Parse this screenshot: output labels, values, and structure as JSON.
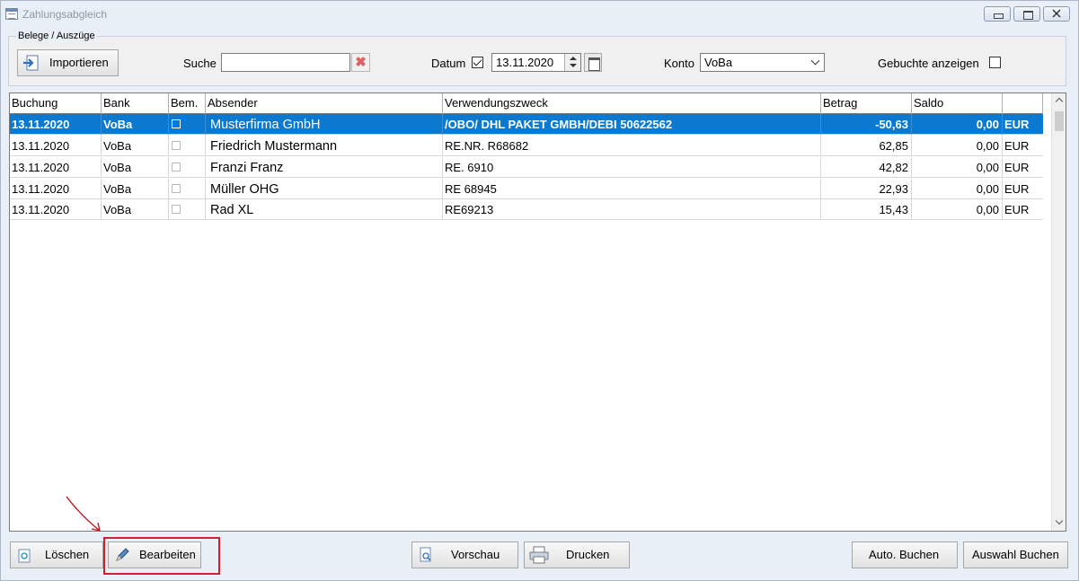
{
  "window": {
    "title": "Zahlungsabgleich"
  },
  "toolbar": {
    "group_label": "Belege / Auszüge",
    "import_label": "Importieren",
    "search_label": "Suche",
    "search_value": "",
    "date_label": "Datum",
    "date_enabled": true,
    "date_value": "13.11.2020",
    "account_label": "Konto",
    "account_value": "VoBa",
    "booked_label": "Gebuchte anzeigen",
    "booked_checked": false
  },
  "grid": {
    "columns": [
      "Buchung",
      "Bank",
      "Bem.",
      "Absender",
      "Verwendungszweck",
      "Betrag",
      "Saldo",
      ""
    ],
    "rows": [
      {
        "date": "13.11.2020",
        "bank": "VoBa",
        "note": false,
        "sender": "Musterfirma GmbH",
        "purpose": "/OBO/ DHL PAKET GMBH/DEBI 50622562",
        "amount": "-50,63",
        "balance": "0,00",
        "currency": "EUR",
        "selected": true
      },
      {
        "date": "13.11.2020",
        "bank": "VoBa",
        "note": false,
        "sender": "Friedrich Mustermann",
        "purpose": "RE.NR. R68682",
        "amount": "62,85",
        "balance": "0,00",
        "currency": "EUR",
        "selected": false
      },
      {
        "date": "13.11.2020",
        "bank": "VoBa",
        "note": false,
        "sender": "Franzi Franz",
        "purpose": "RE. 6910",
        "amount": "42,82",
        "balance": "0,00",
        "currency": "EUR",
        "selected": false
      },
      {
        "date": "13.11.2020",
        "bank": "VoBa",
        "note": false,
        "sender": "Müller OHG",
        "purpose": "RE 68945",
        "amount": "22,93",
        "balance": "0,00",
        "currency": "EUR",
        "selected": false
      },
      {
        "date": "13.11.2020",
        "bank": "VoBa",
        "note": false,
        "sender": "Rad XL",
        "purpose": "RE69213",
        "amount": "15,43",
        "balance": "0,00",
        "currency": "EUR",
        "selected": false
      }
    ]
  },
  "footer": {
    "delete_label": "Löschen",
    "edit_label": "Bearbeiten",
    "preview_label": "Vorschau",
    "print_label": "Drucken",
    "auto_book_label": "Auto. Buchen",
    "select_book_label": "Auswahl Buchen"
  },
  "colors": {
    "selection": "#0b79d0",
    "highlight": "#d0202a"
  }
}
